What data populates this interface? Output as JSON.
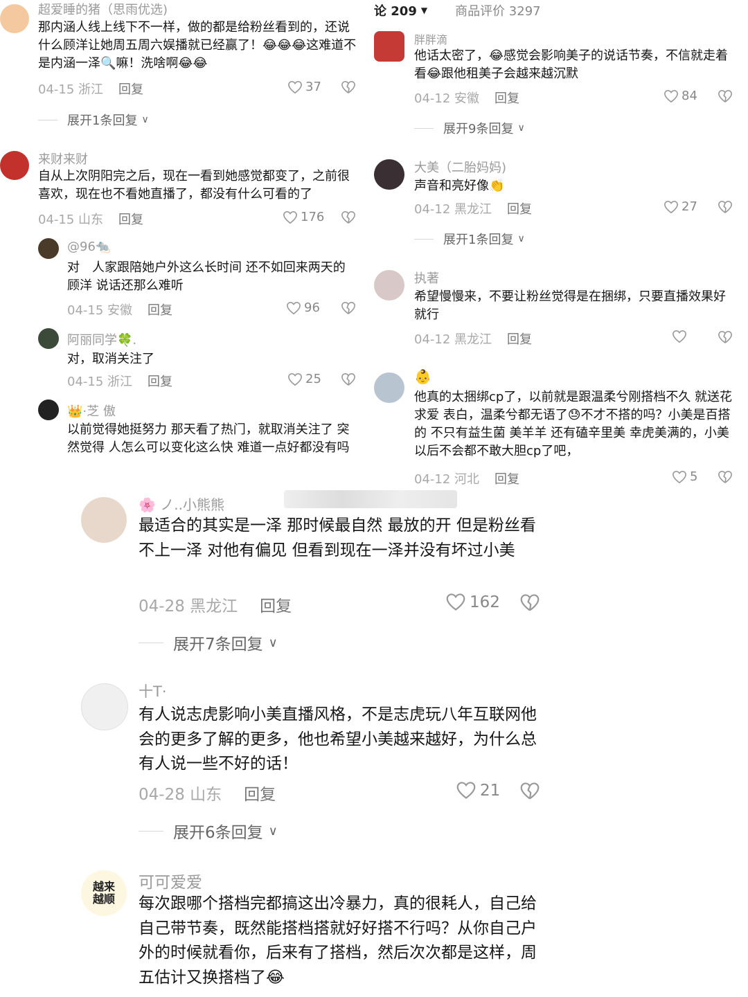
{
  "header": {
    "tab_comments": "论 209",
    "tab_reviews": "商品评价 3297"
  },
  "left_comments": [
    {
      "user": "超爱睡的猪（思雨优选)",
      "text": "那内涵人线上线下不一样，做的都是给粉丝看到的，还说什么顾洋让她周五周六娱播就已经赢了！😂😂😂这难道不是内涵一泽🔍嘛！洗啥啊😂😂",
      "date": "04-15 浙江",
      "reply": "回复",
      "likes": "37",
      "expand": "展开1条回复"
    },
    {
      "user": "来财来财",
      "text": "自从上次阴阳完之后，现在一看到她感觉都变了，之前很喜欢，现在也不看她直播了，都没有什么可看的了",
      "date": "04-15 山东",
      "reply": "回复",
      "likes": "176"
    },
    {
      "user": "@96🐀",
      "text": "对　人家跟陪她户外这么长时间 还不如回来两天的顾洋 说话还那么难听",
      "date": "04-15 安徽",
      "reply": "回复",
      "likes": "96"
    },
    {
      "user": "阿丽同学🍀.",
      "text": "对，取消关注了",
      "date": "04-15 浙江",
      "reply": "回复",
      "likes": "25"
    },
    {
      "user": "👑·芝 傲",
      "text": "以前觉得她挺努力 那天看了热门，就取消关注了 突然觉得 人怎么可以变化这么快 难道一点好都没有吗"
    }
  ],
  "right_comments": [
    {
      "user": "胖胖滴",
      "text": "他话太密了，😂感觉会影响美子的说话节奏，不信就走着看😂跟他租美子会越来越沉默",
      "date": "04-12 安徽",
      "reply": "回复",
      "likes": "84",
      "expand": "展开9条回复"
    },
    {
      "user": "大美（二胎妈妈)",
      "text": "声音和亮好像👏",
      "date": "04-12 黑龙江",
      "reply": "回复",
      "likes": "27",
      "expand": "展开1条回复"
    },
    {
      "user": "执著",
      "text": "希望慢慢来，不要让粉丝觉得是在捆绑，只要直播效果好就行",
      "date": "04-12 黑龙江",
      "reply": "回复",
      "likes": ""
    },
    {
      "user": "👶",
      "text": "他真的太捆绑cp了，以前就是跟温柔兮刚搭档不久 就送花 求爱 表白，温柔兮都无语了😓不才不搭的吗？小美是百搭的 不只有益生菌 美羊羊 还有磕辛里美 幸虎美满的，小美以后不会都不敢大胆cp了吧，",
      "date": "04-12 河北",
      "reply": "回复",
      "likes": "5"
    }
  ],
  "bottom_comments": [
    {
      "user": "🌸 ノ..小熊熊",
      "text": "最适合的其实是一泽 那时候最自然 最放的开 但是粉丝看不上一泽 对他有偏见 但看到现在一泽并没有坏过小美",
      "date": "04-28 黑龙江",
      "reply": "回复",
      "likes": "162",
      "expand": "展开7条回复"
    },
    {
      "user": "十T·",
      "text": "有人说志虎影响小美直播风格，不是志虎玩八年互联网他会的更多了解的更多，他也希望小美越来越好，为什么总有人说一些不好的话！",
      "date": "04-28 山东",
      "reply": "回复",
      "likes": "21",
      "expand": "展开6条回复"
    },
    {
      "user": "可可爱爱",
      "text": "每次跟哪个搭档完都搞这出冷暴力，真的很耗人，自己给自己带节奏，既然能搭档搭就好好搭不行吗？从你自己户外的时候就看你，后来有了搭档，然后次次都是这样，周五估计又换搭档了😂",
      "avatar_text": "越来越顺"
    }
  ],
  "colors": {
    "emoji": "#f6c234",
    "accent": "#3b6fd6"
  }
}
